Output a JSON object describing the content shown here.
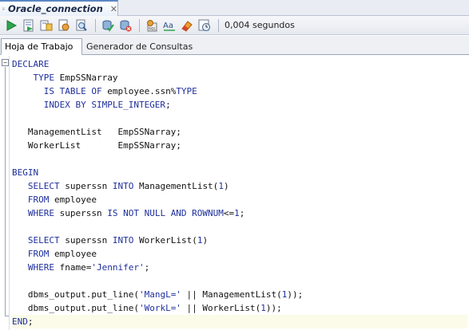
{
  "document_tab": {
    "title": "Oracle_connection",
    "close": "✕"
  },
  "toolbar": {
    "buttons": [
      "run-statement",
      "run-script",
      "autotrace",
      "explain-plan",
      "sql-tuning",
      "commit",
      "rollback",
      "sql-history",
      "spell-case",
      "clear",
      "history"
    ],
    "elapsed": "0,004 segundos"
  },
  "sub_tabs": {
    "worksheet": "Hoja de Trabajo",
    "query_builder": "Generador de Consultas"
  },
  "code_lines": [
    [
      {
        "t": "DECLARE",
        "c": "kw"
      }
    ],
    [
      {
        "t": "    TYPE ",
        "c": "kw"
      },
      {
        "t": "EmpSSNarray",
        "c": "plain"
      }
    ],
    [
      {
        "t": "      IS TABLE OF ",
        "c": "kw"
      },
      {
        "t": "employee.ssn%",
        "c": "plain"
      },
      {
        "t": "TYPE",
        "c": "kw"
      }
    ],
    [
      {
        "t": "      INDEX BY SIMPLE_INTEGER",
        "c": "kw"
      },
      {
        "t": ";",
        "c": "plain"
      }
    ],
    [
      {
        "t": "",
        "c": "plain"
      }
    ],
    [
      {
        "t": "   ManagementList   EmpSSNarray;",
        "c": "plain"
      }
    ],
    [
      {
        "t": "   WorkerList       EmpSSNarray;",
        "c": "plain"
      }
    ],
    [
      {
        "t": "",
        "c": "plain"
      }
    ],
    [
      {
        "t": "BEGIN",
        "c": "kw"
      }
    ],
    [
      {
        "t": "   SELECT ",
        "c": "kw"
      },
      {
        "t": "superssn ",
        "c": "plain"
      },
      {
        "t": "INTO ",
        "c": "kw"
      },
      {
        "t": "ManagementList(",
        "c": "plain"
      },
      {
        "t": "1",
        "c": "num"
      },
      {
        "t": ")",
        "c": "plain"
      }
    ],
    [
      {
        "t": "   FROM ",
        "c": "kw"
      },
      {
        "t": "employee",
        "c": "plain"
      }
    ],
    [
      {
        "t": "   WHERE ",
        "c": "kw"
      },
      {
        "t": "superssn ",
        "c": "plain"
      },
      {
        "t": "IS NOT NULL AND ROWNUM",
        "c": "kw"
      },
      {
        "t": "<=",
        "c": "plain"
      },
      {
        "t": "1",
        "c": "num"
      },
      {
        "t": ";",
        "c": "plain"
      }
    ],
    [
      {
        "t": "",
        "c": "plain"
      }
    ],
    [
      {
        "t": "   SELECT ",
        "c": "kw"
      },
      {
        "t": "superssn ",
        "c": "plain"
      },
      {
        "t": "INTO ",
        "c": "kw"
      },
      {
        "t": "WorkerList(",
        "c": "plain"
      },
      {
        "t": "1",
        "c": "num"
      },
      {
        "t": ")",
        "c": "plain"
      }
    ],
    [
      {
        "t": "   FROM ",
        "c": "kw"
      },
      {
        "t": "employee",
        "c": "plain"
      }
    ],
    [
      {
        "t": "   WHERE ",
        "c": "kw"
      },
      {
        "t": "fname=",
        "c": "plain"
      },
      {
        "t": "'Jennifer'",
        "c": "str"
      },
      {
        "t": ";",
        "c": "plain"
      }
    ],
    [
      {
        "t": "",
        "c": "plain"
      }
    ],
    [
      {
        "t": "   dbms_output.put_line(",
        "c": "plain"
      },
      {
        "t": "'MangL='",
        "c": "str"
      },
      {
        "t": " || ManagementList(",
        "c": "plain"
      },
      {
        "t": "1",
        "c": "num"
      },
      {
        "t": "));",
        "c": "plain"
      }
    ],
    [
      {
        "t": "   dbms_output.put_line(",
        "c": "plain"
      },
      {
        "t": "'WorkL='",
        "c": "str"
      },
      {
        "t": " || WorkerList(",
        "c": "plain"
      },
      {
        "t": "1",
        "c": "num"
      },
      {
        "t": "));",
        "c": "plain"
      }
    ],
    [
      {
        "t": "END",
        "c": "kw"
      },
      {
        "t": ";",
        "c": "plain"
      }
    ]
  ],
  "current_line": 19
}
